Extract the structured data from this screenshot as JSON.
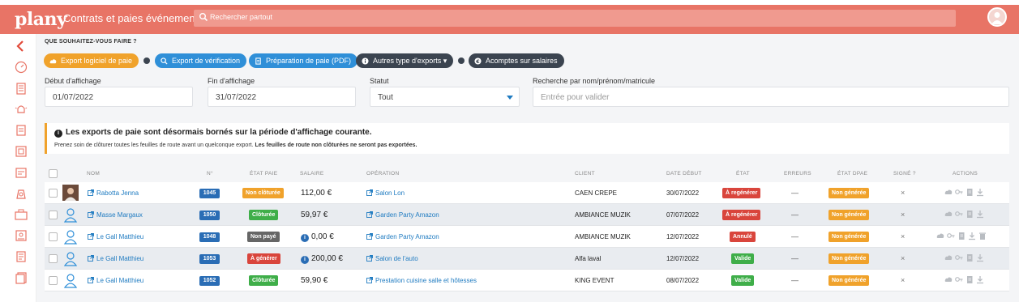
{
  "header": {
    "logo": "plany",
    "app_title": "Contrats et paies événementiel",
    "search_placeholder": "Rechercher partout"
  },
  "sidebar": {
    "items": [
      "back-arrow-icon",
      "speedometer-icon",
      "building-icon",
      "alarm-icon",
      "document-icon",
      "list-icon",
      "settings-doc-icon",
      "money-bag-icon",
      "briefcase-icon",
      "id-card-icon",
      "invoice-icon",
      "file-icon"
    ]
  },
  "actions": {
    "question": "QUE SOUHAITEZ-VOUS FAIRE ?",
    "buttons": [
      {
        "label": "Export logiciel de paie",
        "color": "#f0a22b"
      },
      {
        "label": "Export de vérification",
        "color": "#2f8fd8"
      },
      {
        "label": "Préparation de paie (PDF)",
        "color": "#2f8fd8"
      },
      {
        "label": "Autres type d'exports ▾",
        "color": "#3b4450"
      },
      {
        "label": "Acomptes sur salaires",
        "color": "#3b4450"
      }
    ]
  },
  "filters": {
    "start_label": "Début d'affichage",
    "start_value": "01/07/2022",
    "end_label": "Fin d'affichage",
    "end_value": "31/07/2022",
    "status_label": "Statut",
    "status_value": "Tout",
    "search_label": "Recherche par nom/prénom/matricule",
    "search_placeholder": "Entrée pour valider"
  },
  "notice": {
    "title": "Les exports de paie sont désormais bornés sur la période d'affichage courante.",
    "body_plain": "Prenez soin de clôturer toutes les feuilles de route avant un quelconque export.",
    "body_bold": "Les feuilles de route non clôturées ne seront pas exportées."
  },
  "table": {
    "headers": {
      "nom": "NOM",
      "num": "N°",
      "etat_paie": "ÉTAT PAIE",
      "salaire": "SALAIRE",
      "operation": "OPÉRATION",
      "client": "CLIENT",
      "date_debut": "DATE DÉBUT",
      "etat": "ÉTAT",
      "erreurs": "ERREURS",
      "etat_dpae": "ÉTAT DPAE",
      "signe": "SIGNÉ ?",
      "actions": "ACTIONS"
    },
    "rows": [
      {
        "name": "Rabotta Jenna",
        "num": "1045",
        "etat_paie": "Non clôturée",
        "etat_paie_color": "#f0a22b",
        "salary": "112,00 €",
        "salary_info": false,
        "operation": "Salon Lon",
        "client": "CAEN CREPE",
        "date": "30/07/2022",
        "etat": "À regénérer",
        "etat_color": "#d9453c",
        "errors": "—",
        "dpae": "Non générée",
        "signed": "×",
        "photo": true
      },
      {
        "name": "Masse Margaux",
        "num": "1050",
        "etat_paie": "Clôturée",
        "etat_paie_color": "#3fae49",
        "salary": "59,97 €",
        "salary_info": false,
        "operation": "Garden Party Amazon",
        "client": "AMBIANCE MUZIK",
        "date": "07/07/2022",
        "etat": "À regénérer",
        "etat_color": "#d9453c",
        "errors": "—",
        "dpae": "Non générée",
        "signed": "×",
        "photo": false
      },
      {
        "name": "Le Gall Matthieu",
        "num": "1048",
        "etat_paie": "Non payé",
        "etat_paie_color": "#666666",
        "salary": "0,00 €",
        "salary_info": true,
        "operation": "Garden Party Amazon",
        "client": "AMBIANCE MUZIK",
        "date": "12/07/2022",
        "etat": "Annulé",
        "etat_color": "#d9453c",
        "errors": "—",
        "dpae": "Non générée",
        "signed": "×",
        "photo": false
      },
      {
        "name": "Le Gall Matthieu",
        "num": "1053",
        "etat_paie": "À générer",
        "etat_paie_color": "#d9453c",
        "salary": "200,00 €",
        "salary_info": true,
        "operation": "Salon de l'auto",
        "client": "Alfa laval",
        "date": "12/07/2022",
        "etat": "Valide",
        "etat_color": "#3fae49",
        "errors": "—",
        "dpae": "Non générée",
        "signed": "×",
        "photo": false
      },
      {
        "name": "Le Gall Matthieu",
        "num": "1052",
        "etat_paie": "Clôturée",
        "etat_paie_color": "#3fae49",
        "salary": "59,90 €",
        "salary_info": false,
        "operation": "Prestation cuisine salle et hôtesses",
        "client": "KING EVENT",
        "date": "08/07/2022",
        "etat": "Valide",
        "etat_color": "#3fae49",
        "errors": "—",
        "dpae": "Non générée",
        "signed": "×",
        "photo": false
      }
    ],
    "dpae_color": "#f0a22b"
  }
}
